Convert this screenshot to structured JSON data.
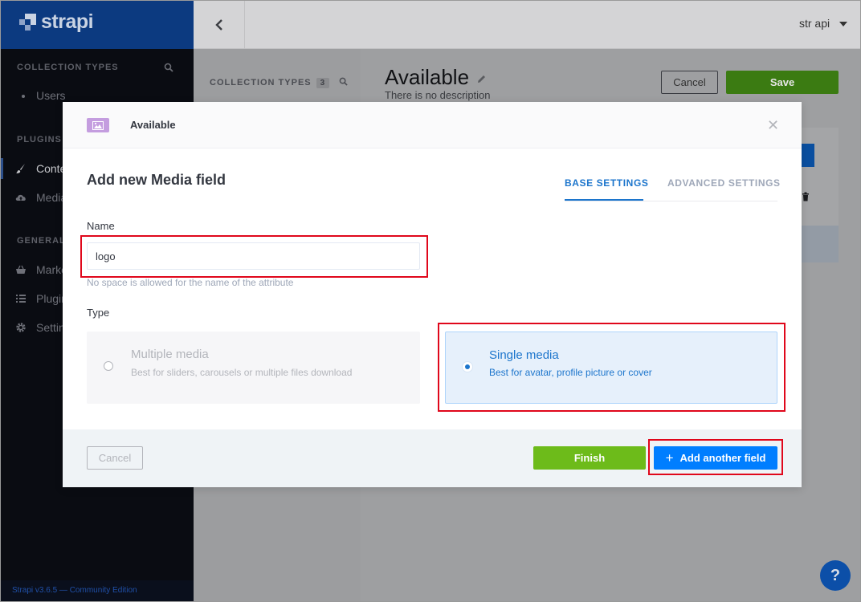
{
  "brand": {
    "name": "strapi"
  },
  "header": {
    "user_label": "str api"
  },
  "sidebar": {
    "sections": [
      {
        "label": "COLLECTION TYPES"
      },
      {
        "label": "PLUGINS"
      },
      {
        "label": "GENERAL"
      }
    ],
    "items": [
      {
        "label": "Users",
        "icon": "bullet-icon"
      },
      {
        "label": "Conte",
        "icon": "brush-icon",
        "active": true
      },
      {
        "label": "Media",
        "icon": "cloud-upload-icon"
      },
      {
        "label": "Marke",
        "icon": "shopping-basket-icon"
      },
      {
        "label": "Plugin",
        "icon": "list-icon"
      },
      {
        "label": "Settin",
        "icon": "gear-icon"
      }
    ],
    "footer": "Strapi v3.6.5 — Community Edition"
  },
  "content_panel": {
    "title": "COLLECTION TYPES",
    "count": "3"
  },
  "page": {
    "title": "Available",
    "description": "There is no description",
    "cancel_label": "Cancel",
    "save_label": "Save"
  },
  "modal": {
    "header_title": "Available",
    "heading": "Add new Media field",
    "tabs": [
      {
        "label": "BASE SETTINGS",
        "active": true
      },
      {
        "label": "ADVANCED SETTINGS",
        "active": false
      }
    ],
    "name_label": "Name",
    "name_value": "logo",
    "name_hint": "No space is allowed for the name of the attribute",
    "type_label": "Type",
    "options": [
      {
        "title": "Multiple media",
        "subtitle": "Best for sliders, carousels or multiple files download",
        "selected": false
      },
      {
        "title": "Single media",
        "subtitle": "Best for avatar, profile picture or cover",
        "selected": true
      }
    ],
    "footer": {
      "cancel_label": "Cancel",
      "finish_label": "Finish",
      "add_label": "Add another field",
      "add_icon": "plus-icon"
    }
  },
  "help": {
    "label": "?"
  },
  "colors": {
    "primary": "#007eff",
    "success": "#6dbb1a",
    "annotation": "#e0071b",
    "media_badge": "#c49ddf"
  }
}
